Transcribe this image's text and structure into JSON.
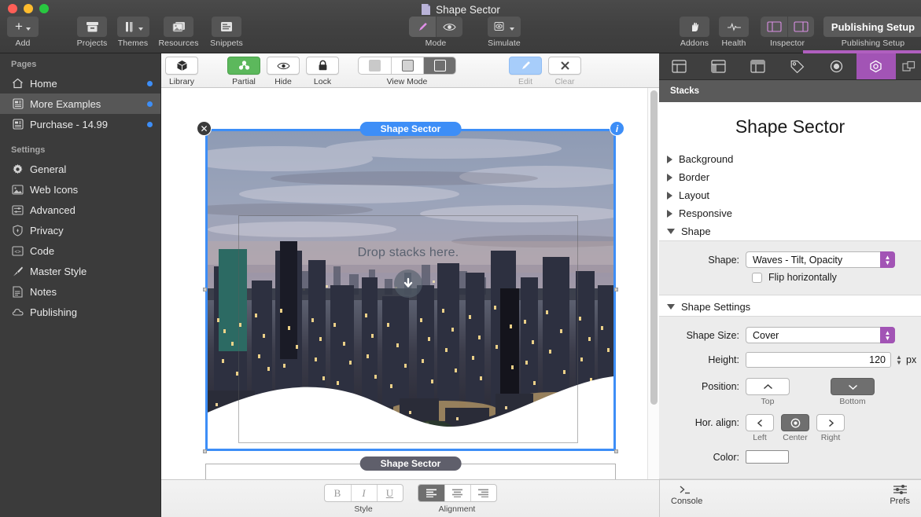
{
  "window": {
    "title": "Shape Sector"
  },
  "toolbar": {
    "add": {
      "label": "Add",
      "icon": "plus-icon"
    },
    "projects": {
      "label": "Projects",
      "icon": "archive-box-icon"
    },
    "themes": {
      "label": "Themes",
      "icon": "paint-icon"
    },
    "resources": {
      "label": "Resources",
      "icon": "photos-icon"
    },
    "snippets": {
      "label": "Snippets",
      "icon": "snippet-window-icon"
    },
    "mode": {
      "label": "Mode",
      "options": [
        "edit-pencil-icon",
        "preview-eye-icon"
      ],
      "selected": 0
    },
    "simulate": {
      "label": "Simulate",
      "icon": "simulate-eye-icon"
    },
    "addons": {
      "label": "Addons",
      "icon": "puzzle-hand-icon"
    },
    "health": {
      "label": "Health",
      "icon": "pulse-icon"
    },
    "inspector": {
      "label": "Inspector",
      "options": [
        "left-panel-icon",
        "right-panel-icon"
      ]
    },
    "publishing": {
      "button_label": "Publishing Setup",
      "label": "Publishing Setup"
    }
  },
  "sidebar": {
    "sections": [
      {
        "heading": "Pages",
        "items": [
          {
            "label": "Home",
            "icon": "house-icon",
            "dot": true,
            "selected": false
          },
          {
            "label": "More Examples",
            "icon": "page-icon",
            "dot": true,
            "selected": true
          },
          {
            "label": "Purchase - 14.99",
            "icon": "page-icon",
            "dot": true,
            "selected": false
          }
        ]
      },
      {
        "heading": "Settings",
        "items": [
          {
            "label": "General",
            "icon": "gear-icon",
            "dot": false,
            "selected": false
          },
          {
            "label": "Web Icons",
            "icon": "image-icon",
            "dot": false,
            "selected": false
          },
          {
            "label": "Advanced",
            "icon": "sliders-icon",
            "dot": false,
            "selected": false
          },
          {
            "label": "Privacy",
            "icon": "shield-icon",
            "dot": false,
            "selected": false
          },
          {
            "label": "Code",
            "icon": "code-icon",
            "dot": false,
            "selected": false
          },
          {
            "label": "Master Style",
            "icon": "brush-icon",
            "dot": false,
            "selected": false
          },
          {
            "label": "Notes",
            "icon": "notes-icon",
            "dot": false,
            "selected": false
          },
          {
            "label": "Publishing",
            "icon": "cloud-icon",
            "dot": false,
            "selected": false
          }
        ]
      }
    ]
  },
  "sub_toolbar": {
    "library": {
      "label": "Library",
      "icon": "cube-icon"
    },
    "partial": {
      "label": "Partial",
      "icon": "stacks-icon",
      "active": true
    },
    "hide": {
      "label": "Hide",
      "icon": "eye-icon"
    },
    "lock": {
      "label": "Lock",
      "icon": "lock-icon"
    },
    "view_mode": {
      "label": "View Mode",
      "selected_index": 2
    },
    "edit": {
      "label": "Edit",
      "icon": "pencil-icon",
      "disabled": true
    },
    "clear": {
      "label": "Clear",
      "icon": "x-icon",
      "disabled": true
    }
  },
  "canvas": {
    "selected_stack_label": "Shape Sector",
    "lower_stack_label": "Shape Sector",
    "drop_text": "Drop stacks here.",
    "drop_icon": "download-arrow-icon",
    "close_icon": "close-icon",
    "info_icon": "info-icon",
    "selection_color": "#3d8ef7",
    "lower_badge_color": "#5f5f6b"
  },
  "format_bar": {
    "style": {
      "label": "Style",
      "buttons": [
        "B",
        "I",
        "U"
      ]
    },
    "alignment": {
      "label": "Alignment",
      "buttons": [
        "align-left-icon",
        "align-center-icon",
        "align-right-icon"
      ],
      "selected_index": 0
    }
  },
  "inspector": {
    "tabs": [
      {
        "icon": "page-layout-icon",
        "active": false
      },
      {
        "icon": "sidebar-layout-icon",
        "active": false
      },
      {
        "icon": "header-layout-icon",
        "active": false
      },
      {
        "icon": "tag-icon",
        "active": false
      },
      {
        "icon": "target-icon",
        "active": false
      },
      {
        "icon": "stacks-hex-icon",
        "active": true
      },
      {
        "icon": "windows-icon",
        "active": false
      }
    ],
    "accent_color": "#a254b5",
    "subtitle": "Stacks",
    "title": "Shape Sector",
    "sections": [
      {
        "label": "Background",
        "open": false
      },
      {
        "label": "Border",
        "open": false
      },
      {
        "label": "Layout",
        "open": false
      },
      {
        "label": "Responsive",
        "open": false
      },
      {
        "label": "Shape",
        "open": true
      }
    ],
    "shape": {
      "shape_label": "Shape:",
      "shape_value": "Waves - Tilt, Opacity",
      "flip_label": "Flip horizontally",
      "flip_checked": false
    },
    "shape_settings": {
      "heading": "Shape Settings",
      "size_label": "Shape Size:",
      "size_value": "Cover",
      "height_label": "Height:",
      "height_value": "120",
      "height_unit": "px",
      "position_label": "Position:",
      "position_top": "Top",
      "position_bottom": "Bottom",
      "position_selected": "Bottom",
      "hor_align_label": "Hor. align:",
      "hor_left": "Left",
      "hor_center": "Center",
      "hor_right": "Right",
      "hor_selected": "Center",
      "color_label": "Color:",
      "color_value": "#ffffff"
    },
    "bottom": {
      "console_label": "Console",
      "console_icon": "terminal-icon",
      "prefs_label": "Prefs",
      "prefs_icon": "sliders-icon"
    }
  }
}
